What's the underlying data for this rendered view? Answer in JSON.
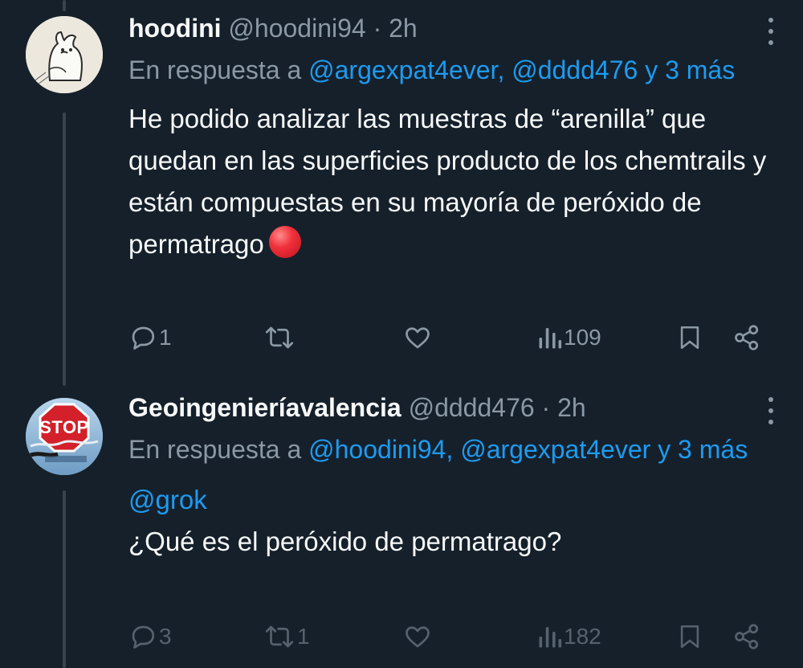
{
  "tweets": [
    {
      "display_name": "hoodini",
      "handle": "@hoodini94",
      "separator": "·",
      "time": "2h",
      "reply_prefix": "En respuesta a",
      "reply_links": "@argexpat4ever, @dddd476 y 3 más",
      "body": "He podido analizar las muestras de “arenilla” que quedan en las superficies producto de los chemtrails y están compuestas en su mayoría de peróxido de permatrago",
      "emoji": "red-circle-emoji",
      "stats": {
        "replies": "1",
        "retweets": "",
        "likes": "",
        "views": "109"
      }
    },
    {
      "display_name": "Geoingenieríavalencia",
      "handle": "@dddd476",
      "separator": "·",
      "time": "2h",
      "reply_prefix": "En respuesta a",
      "reply_links": "@hoodini94, @argexpat4ever y 3 más",
      "mention": "@grok",
      "body": "¿Qué es el peróxido de permatrago?",
      "stats": {
        "replies": "3",
        "retweets": "1",
        "likes": "",
        "views": "182"
      }
    }
  ],
  "avatar2_text": "STOP",
  "icons": [
    "more-icon",
    "reply-icon",
    "retweet-icon",
    "like-icon",
    "views-icon",
    "bookmark-icon",
    "share-icon"
  ],
  "colors": {
    "background": "#15202b",
    "text": "#f7f9f9",
    "muted": "#8b98a5",
    "link": "#1d9bf0",
    "thread_line": "#38444d"
  }
}
